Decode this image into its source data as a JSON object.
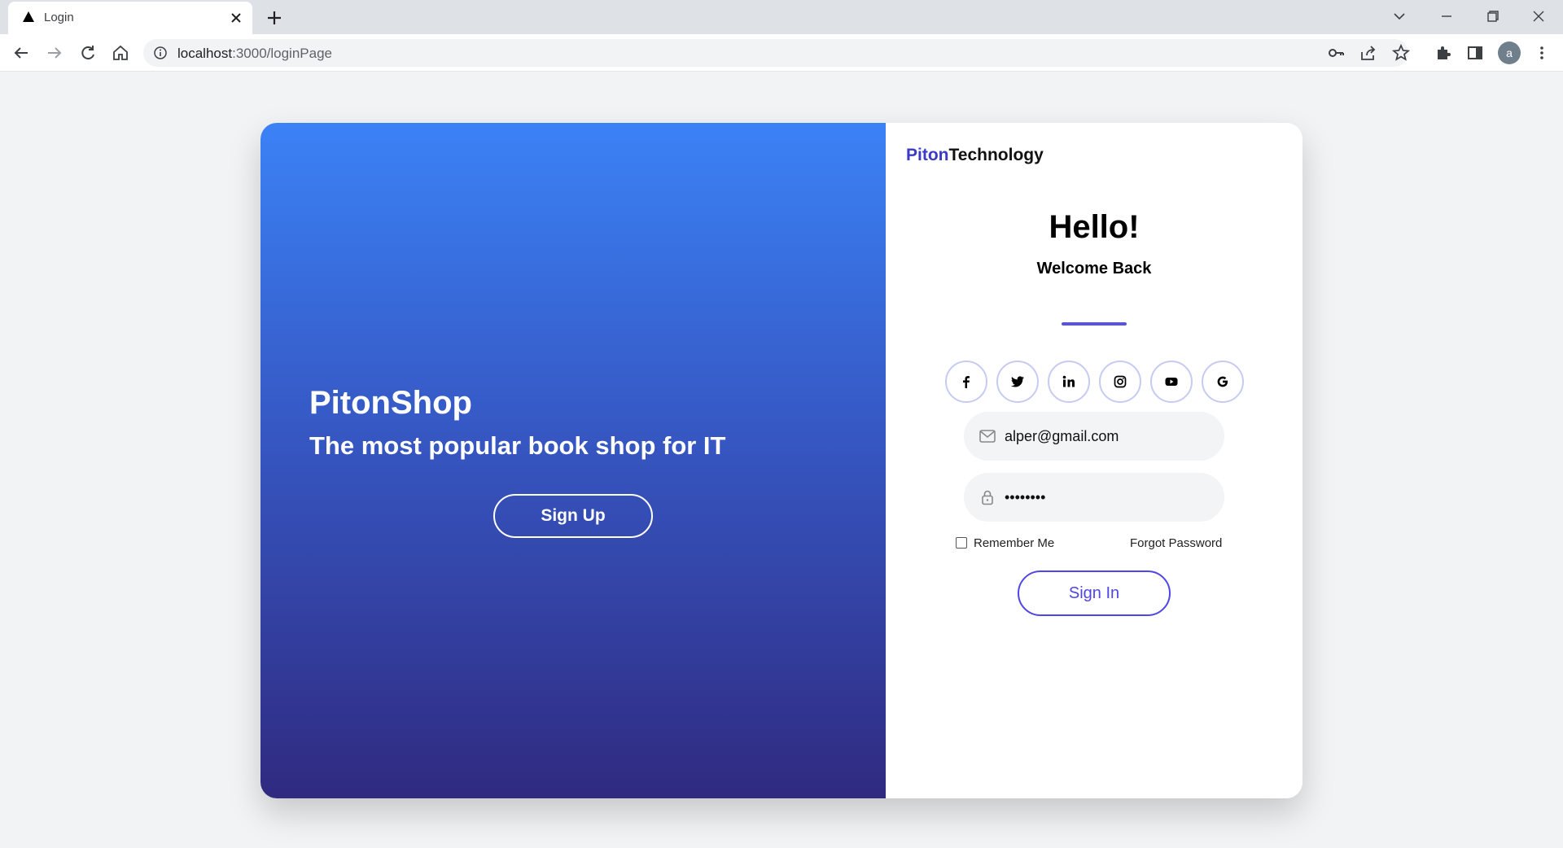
{
  "browser": {
    "tab_title": "Login",
    "url_host": "localhost",
    "url_path": ":3000/loginPage",
    "profile_initial": "a"
  },
  "left": {
    "title": "PitonShop",
    "subtitle": "The most popular book shop for IT",
    "signup_label": "Sign Up"
  },
  "right": {
    "brand_part1": "Piton",
    "brand_part2": "Technology",
    "hello": "Hello!",
    "welcome": "Welcome Back",
    "socials": [
      "facebook-icon",
      "twitter-icon",
      "linkedin-icon",
      "instagram-icon",
      "youtube-icon",
      "google-icon"
    ],
    "email_value": "alper@gmail.com",
    "password_value": "••••••••",
    "remember_label": "Remember Me",
    "forgot_label": "Forgot Password",
    "signin_label": "Sign In"
  },
  "colors": {
    "gradient_top": "#3b82f6",
    "gradient_bottom": "#302a80",
    "accent": "#4f46e5",
    "brand_blue": "#3b3bc6"
  }
}
